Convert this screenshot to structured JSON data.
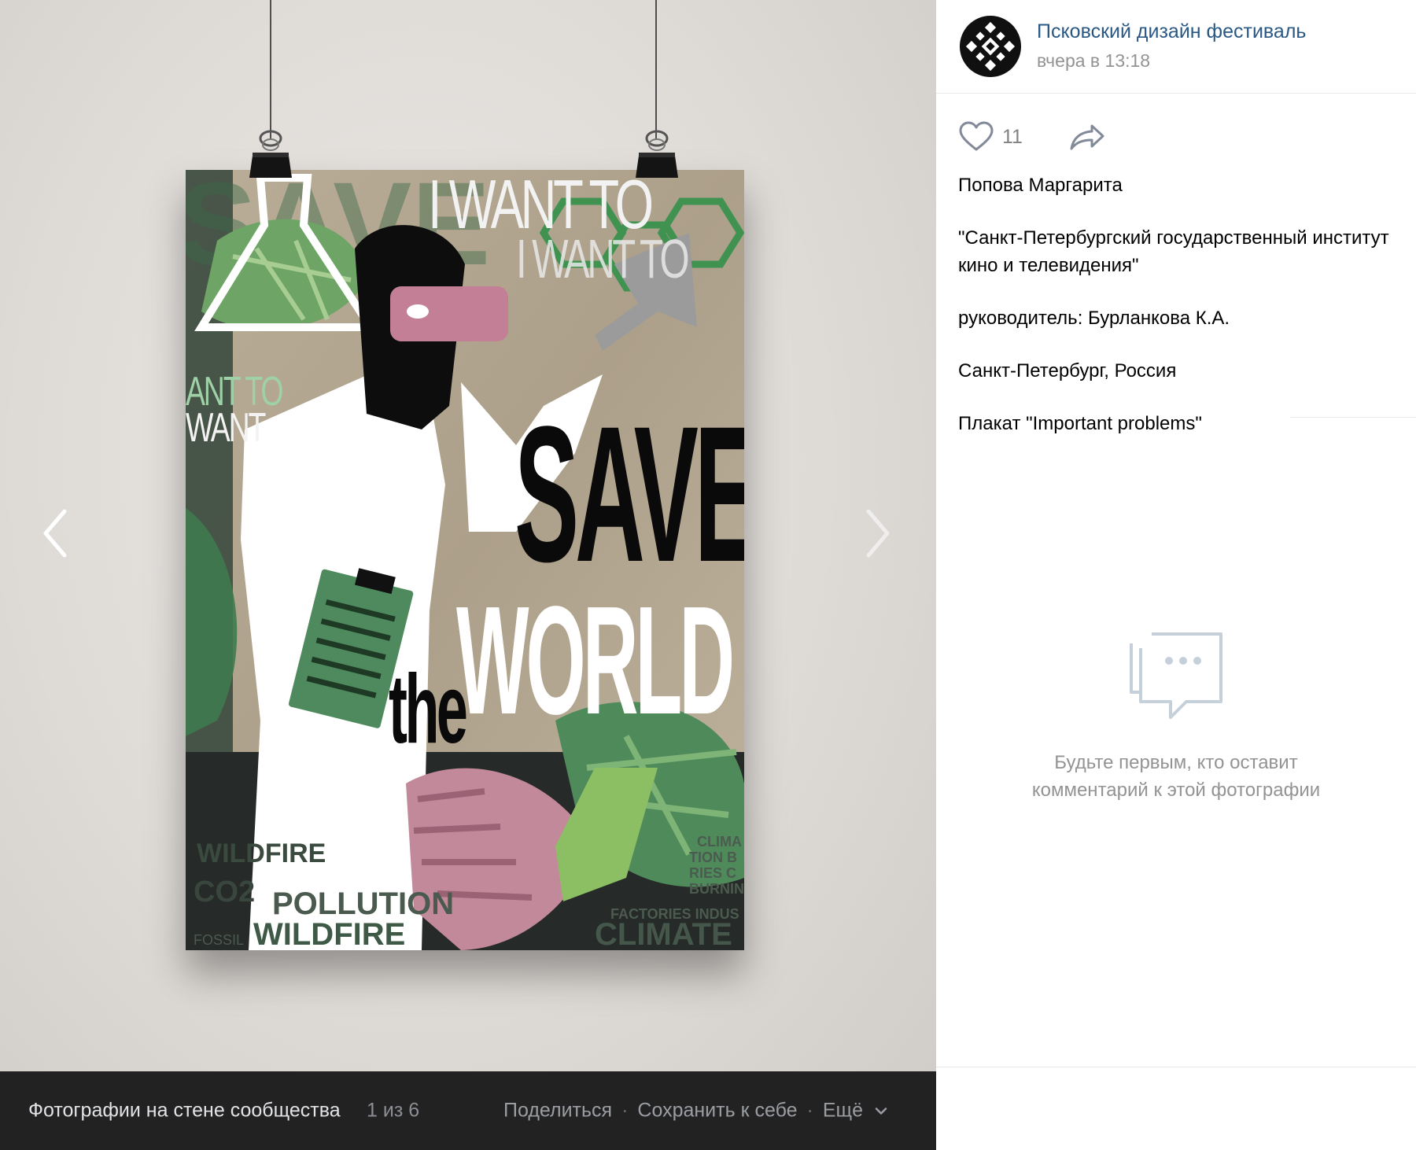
{
  "viewer": {
    "prev_icon": "chevron-left-icon",
    "next_icon": "chevron-right-icon",
    "poster": {
      "heading_line": "I WANT TO",
      "save": "SAVE",
      "the": "the",
      "world": "WORLD",
      "side_text_1": "ANT TO",
      "side_text_2": "WANT",
      "bottom_words": [
        "WILDFIRE",
        "POLLUTION",
        "CO2",
        "FOSSIL",
        "CLIMATE",
        "FACTORIES INDUS",
        "BURNIN",
        "RIES C",
        "TION B",
        "CLIMA"
      ]
    }
  },
  "bottom_bar": {
    "title": "Фотографии на стене сообщества",
    "counter": "1 из 6",
    "share": "Поделиться",
    "save": "Сохранить к себе",
    "more": "Ещё"
  },
  "side_panel": {
    "group_name": "Псковский дизайн фестиваль",
    "post_time": "вчера в 13:18",
    "likes": "11",
    "description": [
      "Попова Маргарита",
      "\"Санкт-Петербургский государственный институт кино и телевидения\"",
      "руководитель: Бурланкова К.А.",
      "Санкт-Петербург, Россия",
      "Плакат \"Important problems\""
    ],
    "empty_comments": "Будьте первым, кто оставит комментарий к этой фотографии"
  },
  "colors": {
    "link": "#2a5885",
    "muted": "#939393",
    "bar_bg": "#222222",
    "poster_green": "#4f8a5b",
    "poster_pink": "#c58497",
    "poster_kraft": "#b3a792"
  }
}
